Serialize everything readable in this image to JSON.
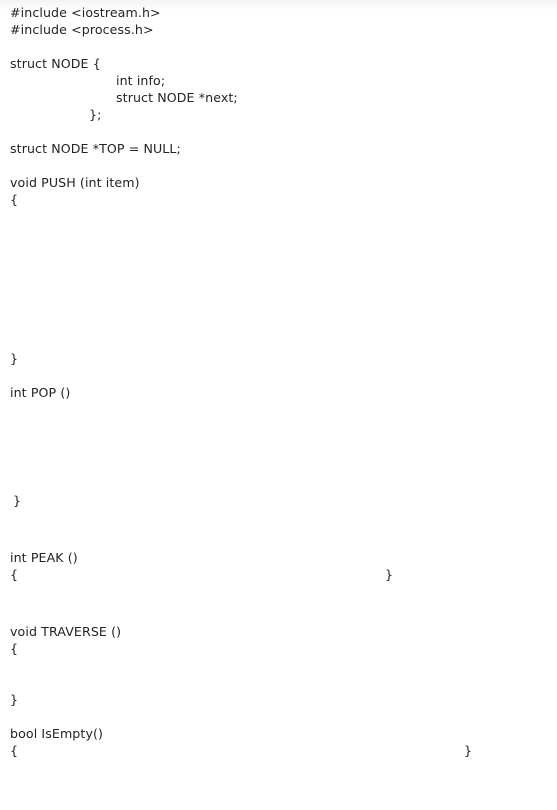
{
  "document": {
    "kind": "source-code-listing",
    "language": "C++",
    "background_color": "#ffffff",
    "text_color": "#222326",
    "lines": [
      {
        "id": "include-iostream",
        "text": "#include <iostream.h>",
        "indent": "col-0"
      },
      {
        "id": "include-process",
        "text": "#include <process.h>",
        "indent": "col-0"
      },
      {
        "id": "struct-open",
        "text": "struct NODE {",
        "indent": "col-0"
      },
      {
        "id": "struct-field-info",
        "text": "int info;",
        "indent": "col-body"
      },
      {
        "id": "struct-field-next",
        "text": "struct NODE *next;",
        "indent": "col-body"
      },
      {
        "id": "struct-close",
        "text": "};",
        "indent": "col-semi"
      },
      {
        "id": "global-top",
        "text": "struct NODE *TOP = NULL;",
        "indent": "col-0"
      },
      {
        "id": "push-signature",
        "text": "void PUSH (int item)",
        "indent": "col-0"
      },
      {
        "id": "push-open-brace",
        "text": "{",
        "indent": "col-0"
      },
      {
        "id": "push-close-brace",
        "text": "}",
        "indent": "col-0"
      },
      {
        "id": "pop-signature",
        "text": "int POP ()",
        "indent": "col-0"
      },
      {
        "id": "pop-close-brace",
        "text": "}",
        "indent": "col-1sp"
      },
      {
        "id": "peak-signature",
        "text": "int PEAK ()",
        "indent": "col-0"
      },
      {
        "id": "peak-open-brace",
        "text": "{",
        "indent": "col-0"
      },
      {
        "id": "peak-close-brace",
        "text": "}",
        "indent": "col-r385"
      },
      {
        "id": "traverse-signature",
        "text": "void TRAVERSE ()",
        "indent": "col-0"
      },
      {
        "id": "traverse-open-brace",
        "text": "{",
        "indent": "col-0"
      },
      {
        "id": "traverse-close-brace",
        "text": "}",
        "indent": "col-0"
      },
      {
        "id": "isempty-signature",
        "text": "bool IsEmpty()",
        "indent": "col-0"
      },
      {
        "id": "isempty-open-brace",
        "text": "{",
        "indent": "col-0"
      },
      {
        "id": "isempty-close-brace",
        "text": "}",
        "indent": "col-r464"
      }
    ]
  }
}
